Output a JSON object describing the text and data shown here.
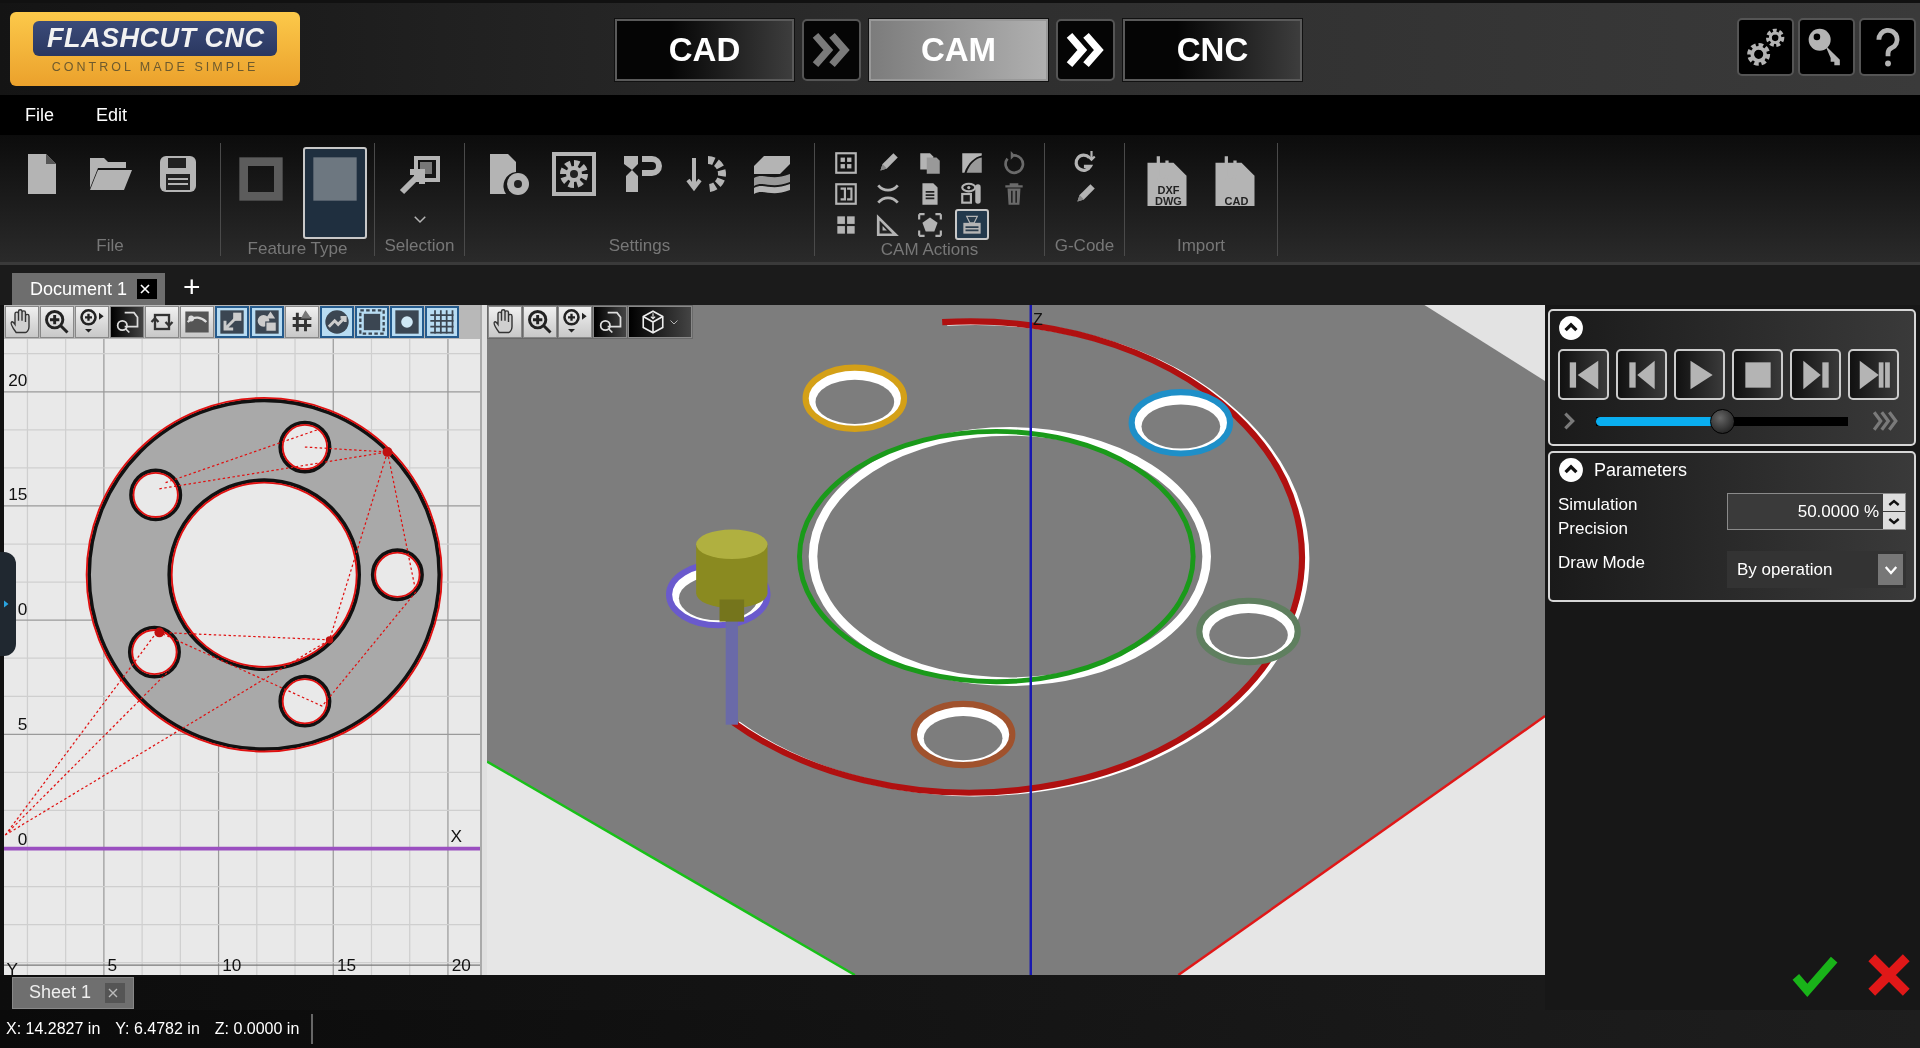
{
  "logo": {
    "name": "FLASHCUT CNC",
    "tagline": "CONTROL MADE SIMPLE"
  },
  "mode_tabs": [
    {
      "label": "CAD",
      "selected": false
    },
    {
      "label": "CAM",
      "selected": true
    },
    {
      "label": "CNC",
      "selected": false
    }
  ],
  "menu": [
    "File",
    "Edit"
  ],
  "ribbon": [
    {
      "kind": "file",
      "label": "File"
    },
    {
      "kind": "feature",
      "label": "Feature Type",
      "buttons": [
        {
          "selected": false
        },
        {
          "selected": true
        }
      ]
    },
    {
      "kind": "selection",
      "label": "Selection"
    },
    {
      "kind": "settings",
      "label": "Settings"
    },
    {
      "kind": "cam",
      "label": "CAM Actions",
      "buttons": [
        {
          "selected": false
        },
        {
          "selected": false
        },
        {
          "selected": false
        },
        {
          "selected": false
        },
        {
          "selected": false
        },
        {
          "selected": false
        },
        {
          "selected": false
        },
        {
          "selected": false
        },
        {
          "selected": false
        },
        {
          "selected": false
        },
        {
          "selected": false
        },
        {
          "selected": true
        },
        {
          "selected": false
        },
        {
          "selected": false
        }
      ]
    },
    {
      "kind": "gcode",
      "label": "G-Code"
    },
    {
      "kind": "import",
      "label": "Import",
      "buttons": [
        {
          "text": "DXF DWG"
        },
        {
          "text": "CAD"
        }
      ]
    }
  ],
  "document_tabs": [
    {
      "label": "Document 1",
      "selected": true
    }
  ],
  "add_tab": "+",
  "view_2d": {
    "tools": [
      {
        "selected": false
      },
      {
        "selected": false
      },
      {
        "selected": false
      },
      {
        "selected": false
      },
      {
        "selected": false
      },
      {
        "selected": false
      },
      {
        "selected": true
      },
      {
        "selected": true
      },
      {
        "selected": false
      },
      {
        "selected": true
      },
      {
        "selected": true
      },
      {
        "selected": true
      },
      {
        "selected": true
      }
    ],
    "y_axis_labels": [
      "20",
      "15",
      "0",
      "5",
      "0"
    ],
    "x_axis_labels": [
      "5",
      "10",
      "15",
      "20"
    ],
    "x_axis_name": "X",
    "y_axis_name": "Y"
  },
  "view_3d": {
    "axis_label": "Z"
  },
  "simulation": {
    "slider": {
      "level": 0.5
    }
  },
  "parameters": {
    "title": "Parameters",
    "fields": [
      {
        "kind": "spinner",
        "label": "Simulation Precision",
        "value": "50.0000 %"
      },
      {
        "kind": "dropdown",
        "label": "Draw Mode",
        "value": "By operation"
      }
    ]
  },
  "sheet_tabs": [
    {
      "label": "Sheet 1",
      "selected": true
    }
  ],
  "status_bar": [
    "X: 14.2827 in",
    "Y: 6.4782 in",
    "Z: 0.0000 in"
  ]
}
